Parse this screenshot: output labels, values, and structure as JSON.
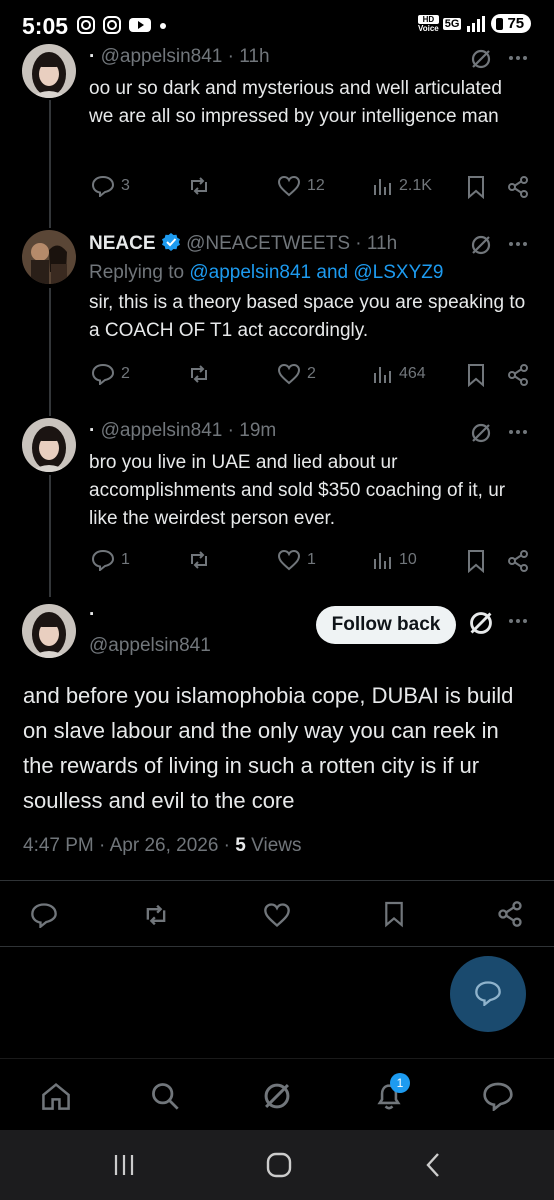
{
  "status_bar": {
    "time": "5:05",
    "battery": "75",
    "network": "5G",
    "hd_label": "HD",
    "voice_label": "Voice"
  },
  "replies": [
    {
      "name": "·",
      "handle": "@appelsin841",
      "time": "11h",
      "text": "oo ur so dark and mysterious and well articulated we are all so impressed by your intelligence man",
      "replies": "3",
      "reposts": "",
      "likes": "12",
      "views": "2.1K"
    },
    {
      "name": "NEACE",
      "handle": "@NEACETWEETS",
      "time": "11h",
      "replying_label": "Replying to",
      "replying_to": "@appelsin841 and @LSXYZ9",
      "text": "sir, this is a theory based space you are speaking to a COACH OF T1 act accordingly.",
      "replies": "2",
      "reposts": "",
      "likes": "2",
      "views": "464"
    },
    {
      "name": "·",
      "handle": "@appelsin841",
      "time": "19m",
      "text": "bro you live in UAE and lied about ur accomplishments and sold $350 coaching of it, ur like the weirdest person ever.",
      "replies": "1",
      "reposts": "",
      "likes": "1",
      "views": "10"
    }
  ],
  "main_post": {
    "name": "·",
    "handle": "@appelsin841",
    "follow_label": "Follow back",
    "text": "and before you islamophobia cope, DUBAI is build on slave labour and the only way you can reek in the rewards of living in such a rotten city is if ur soulless and evil to the core",
    "timestamp": "4:47 PM · Apr 26, 2026 · ",
    "views_count": "5",
    "views_label": " Views"
  },
  "bottom_nav": {
    "notifications_badge": "1"
  },
  "colors": {
    "accent": "#1d9bf0",
    "fab": "#1a4a6e",
    "muted": "#71767b"
  }
}
